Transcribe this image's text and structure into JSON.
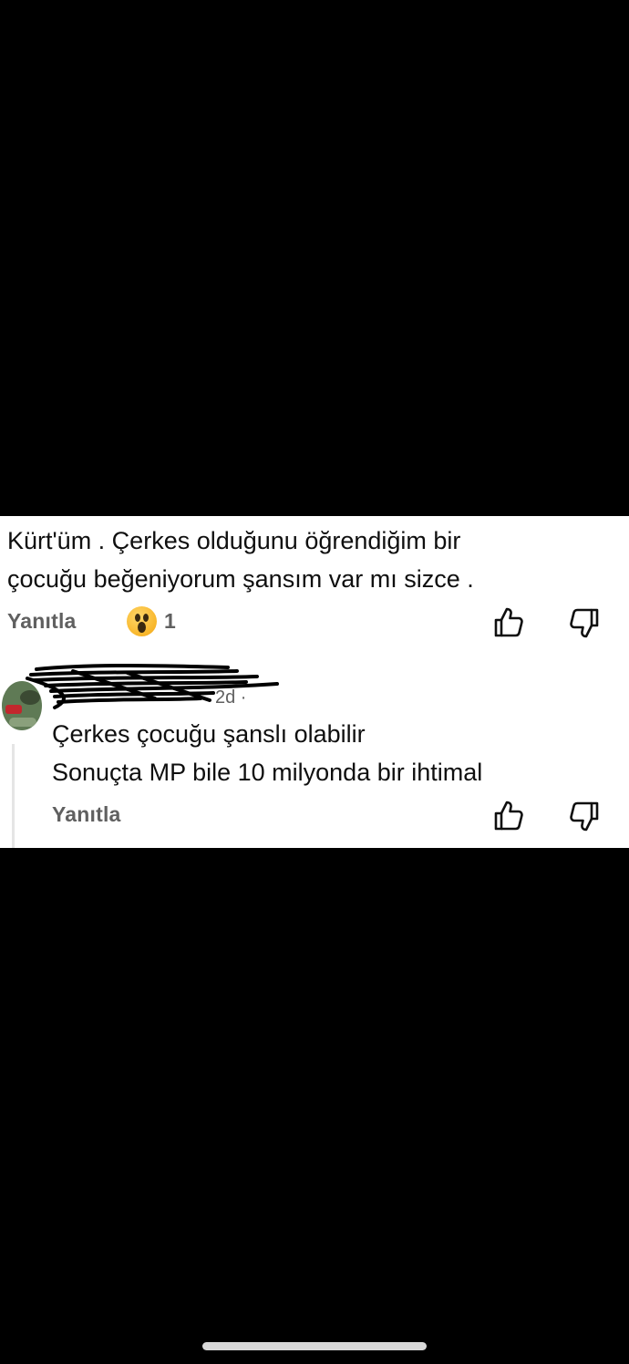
{
  "comment": {
    "text_lines": [
      "Kürt'üm . Çerkes olduğunu öğrendiğim bir",
      "çocuğu beğeniyorum şansım var mı sizce ."
    ],
    "reply_label": "Yanıtla",
    "reaction": {
      "emoji": "astonished-face",
      "count": "1"
    }
  },
  "reply": {
    "meta_fragment": "2d ·",
    "text_lines": [
      "Çerkes çocuğu şanslı olabilir",
      "Sonuçta MP bile 10 milyonda bir ihtimal"
    ],
    "reply_label": "Yanıtla"
  },
  "colors": {
    "background_black": "#000000",
    "panel_white": "#ffffff",
    "text_primary": "#0f0f0f",
    "text_secondary": "#606060",
    "home_indicator": "#d9d9d9"
  }
}
